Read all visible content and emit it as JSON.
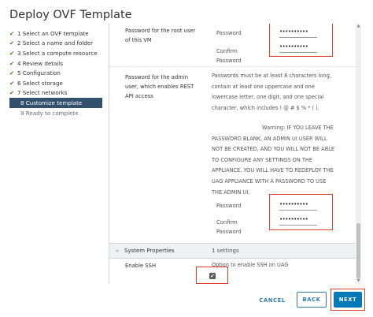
{
  "window": {
    "title": "Deploy OVF Template"
  },
  "nav": {
    "steps": [
      {
        "label": "1 Select an OVF template",
        "state": "done"
      },
      {
        "label": "2 Select a name and folder",
        "state": "done"
      },
      {
        "label": "3 Select a compute resource",
        "state": "done"
      },
      {
        "label": "4 Review details",
        "state": "done"
      },
      {
        "label": "5 Configuration",
        "state": "done"
      },
      {
        "label": "6 Select storage",
        "state": "done"
      },
      {
        "label": "7 Select networks",
        "state": "done"
      },
      {
        "label": "8 Customize template",
        "state": "active"
      },
      {
        "label": "9 Ready to complete",
        "state": "pending"
      }
    ],
    "check_glyph": "✔"
  },
  "root_password": {
    "label_line1": "Password for the root user",
    "label_line2": "of this VM",
    "password_label": "Password",
    "password_value": "••••••••••",
    "confirm_label_line1": "Confirm",
    "confirm_label_line2": "Password",
    "confirm_value": "••••••••••"
  },
  "admin_password": {
    "label_line1": "Password for the admin",
    "label_line2": "user, which enables REST",
    "label_line3": "API access",
    "desc_lines": [
      "Passwords must be at least 8 characters long,",
      "contain at least one uppercase and one",
      "lowercase letter, one digit, and one special",
      "character, which includes ! @ # $ % * ( )."
    ],
    "warning_lines": [
      "Warning: IF YOU LEAVE THE",
      "PASSWORD BLANK, AN ADMIN UI USER WILL",
      "NOT BE CREATED, AND YOU WILL NOT BE ABLE",
      "TO CONFIGURE ANY SETTINGS ON THE",
      "APPLIANCE. YOU WILL HAVE TO REDEPLOY THE",
      "UAG APPLIANCE WITH A PASSWORD TO USE",
      "THE ADMIN UI."
    ],
    "password_label": "Password",
    "password_value": "••••••••••",
    "confirm_label_line1": "Confirm",
    "confirm_label_line2": "Password",
    "confirm_value": "••••••••••"
  },
  "system_properties": {
    "chevron": "⌄",
    "title": "System Properties",
    "count": "1 settings",
    "ssh_label": "Enable SSH",
    "ssh_desc": "Option to enable SSH on UAG",
    "ssh_checked": true,
    "check_glyph": "✔"
  },
  "scrollbar": {
    "up": "▲",
    "down": "▼"
  },
  "footer": {
    "cancel_label": "CANCEL",
    "back_label": "BACK",
    "next_label": "NEXT"
  },
  "colors": {
    "highlight": "#d9412b",
    "accent": "#0079b8",
    "nav_active": "#324f6d",
    "check_green": "#3c8f1e"
  }
}
